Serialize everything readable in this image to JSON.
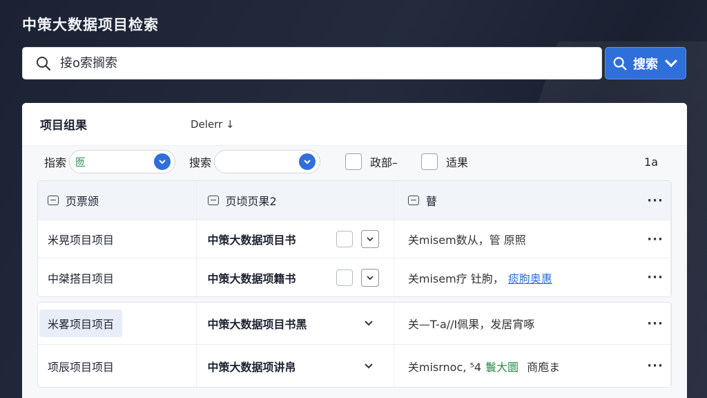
{
  "header": {
    "title": "中策大数据项目检索"
  },
  "search": {
    "placeholder": "接o索搁索",
    "button_label": "搜索"
  },
  "panel": {
    "title": "项目组果",
    "sort_label": "Delerr ↓",
    "filters": {
      "filter1_label": "指索",
      "filter1_value": "匢",
      "filter2_label": "搜索",
      "filter2_value": "",
      "check1_label": "政部–",
      "check2_label": "适果",
      "count": "1a"
    },
    "table1": {
      "headers": [
        "页票颁",
        "页顷页果2",
        "瞽"
      ],
      "rows": [
        {
          "c1": "米晃项目项目",
          "c2": "中策大数据项目书",
          "c3": "关misem数从，管 原照",
          "c3_link": ""
        },
        {
          "c1": "中桀搭目项目",
          "c2": "中策大数据项籍书",
          "c3": "关misem疗 钍朐，",
          "c3_link": "痰朐奥惠"
        }
      ]
    },
    "table2": {
      "rows": [
        {
          "c1": "米畧项目项百",
          "c2": "中策大数据项目书黑",
          "c3": "关—T-a//I佩果，发居宵啄",
          "c3_tag": ""
        },
        {
          "c1": "项辰项目项目",
          "c2": "中策大数据项讲帛",
          "c3": "关misrnoc, ⁵4",
          "c3_tag": "鬟大圜",
          "c3_tail": "商庖ま"
        }
      ]
    }
  }
}
